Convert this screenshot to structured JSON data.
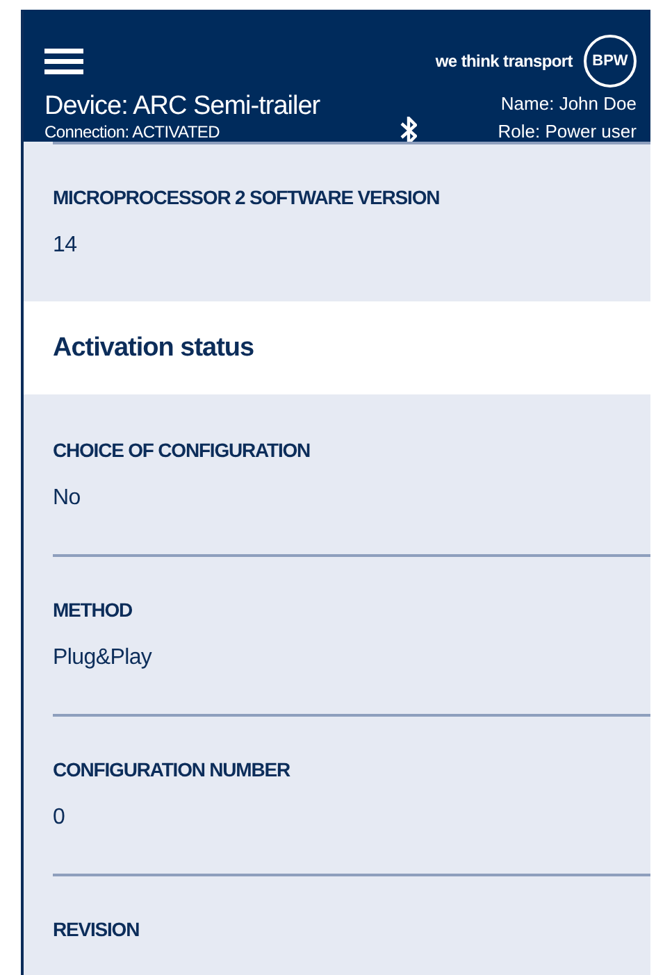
{
  "header": {
    "tagline": "we think transport",
    "logo_text": "BPW",
    "device": "Device: ARC Semi-trailer",
    "connection": "Connection: ACTIVATED",
    "user_name": "Name: John Doe",
    "user_role": "Role: Power user"
  },
  "items": [
    {
      "kind": "field",
      "label": "MICROPROCESSOR 2 SOFTWARE VERSION",
      "value": "14"
    },
    {
      "kind": "heading",
      "label": "Activation status"
    },
    {
      "kind": "field",
      "label": "CHOICE OF CONFIGURATION",
      "value": "No"
    },
    {
      "kind": "field",
      "label": "METHOD",
      "value": "Plug&Play"
    },
    {
      "kind": "field",
      "label": "CONFIGURATION NUMBER",
      "value": "0"
    },
    {
      "kind": "field",
      "label": "REVISION"
    }
  ]
}
